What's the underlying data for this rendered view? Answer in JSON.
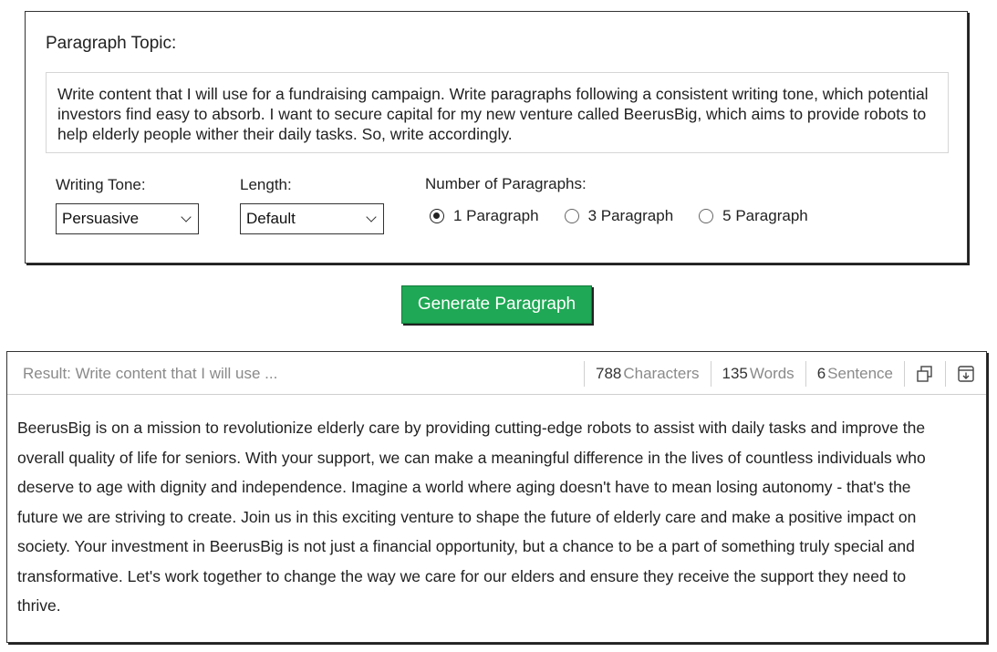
{
  "topic": {
    "label": "Paragraph Topic:",
    "text": "Write content that I will use for a fundraising campaign. Write paragraphs following a consistent writing tone, which potential investors find easy to absorb. I want to secure capital for my new venture called BeerusBig, which aims to provide robots to help elderly people wither their daily tasks. So, write accordingly."
  },
  "tone": {
    "label": "Writing Tone:",
    "value": "Persuasive"
  },
  "length": {
    "label": "Length:",
    "value": "Default"
  },
  "paragraphs": {
    "label": "Number of Paragraphs:",
    "options": [
      "1 Paragraph",
      "3 Paragraph",
      "5 Paragraph"
    ],
    "selected": "1 Paragraph"
  },
  "generate_button": "Generate Paragraph",
  "result": {
    "title": "Result: Write content that I will use ...",
    "characters": {
      "count": "788",
      "unit": "Characters"
    },
    "words": {
      "count": "135",
      "unit": "Words"
    },
    "sentences": {
      "count": "6",
      "unit": "Sentence"
    },
    "icons": [
      "copy-icon",
      "download-icon"
    ],
    "text": "BeerusBig is on a mission to revolutionize elderly care by providing cutting-edge robots to assist with daily tasks and improve the overall quality of life for seniors. With your support, we can make a meaningful difference in the lives of countless individuals who deserve to age with dignity and independence. Imagine a world where aging doesn't have to mean losing autonomy - that's the future we are striving to create. Join us in this exciting venture to shape the future of elderly care and make a positive impact on society. Your investment in BeerusBig is not just a financial opportunity, but a chance to be a part of something truly special and transformative. Let's work together to change the way we care for our elders and ensure they receive the support they need to thrive."
  },
  "colors": {
    "accent": "#1fa855",
    "muted_text": "#8a8a8a"
  }
}
